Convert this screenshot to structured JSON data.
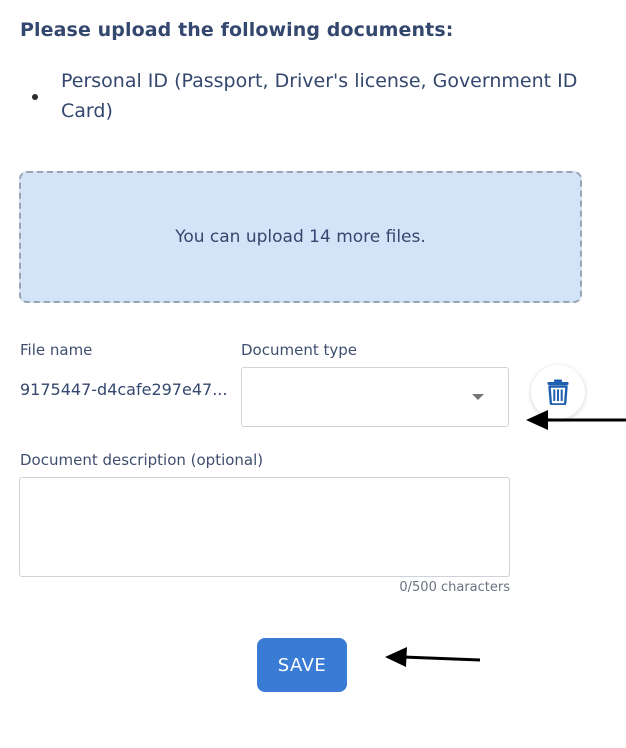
{
  "heading": "Please upload the following documents:",
  "documents": [
    "Personal ID (Passport, Driver's license, Government ID Card)"
  ],
  "dropzone": {
    "text": "You can upload 14 more files."
  },
  "file_row": {
    "file_name_label": "File name",
    "file_name_value": "9175447-d4cafe297e47...",
    "document_type_label": "Document type",
    "document_type_value": "",
    "delete_icon": "trash-icon"
  },
  "description": {
    "label": "Document description (optional)",
    "value": "",
    "counter": "0/500 characters"
  },
  "save_label": "SAVE",
  "colors": {
    "accent": "#3a7bd5",
    "dropzone_bg": "#d3e4f8",
    "text": "#34476e",
    "arrow": "#000000"
  },
  "annotations": {
    "arrows": [
      "arrow-left",
      "arrow-left"
    ]
  }
}
